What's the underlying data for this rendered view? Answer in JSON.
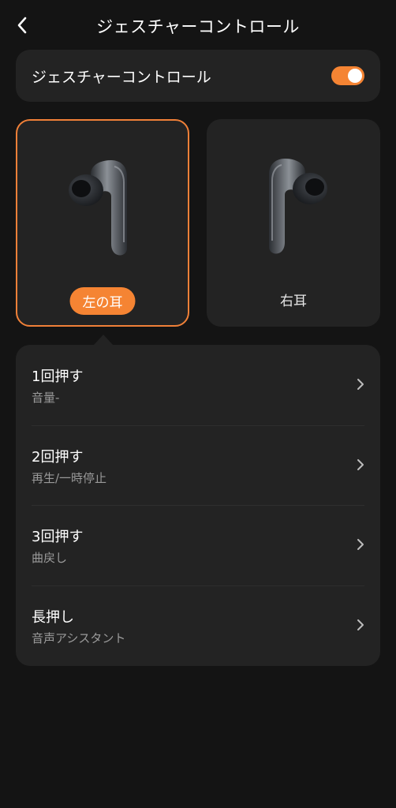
{
  "header": {
    "title": "ジェスチャーコントロール",
    "back_icon": "chevron-left-icon"
  },
  "gesture_toggle": {
    "label": "ジェスチャーコントロール",
    "enabled": true,
    "color": "#f58433"
  },
  "ears": [
    {
      "label": "左の耳",
      "selected": true
    },
    {
      "label": "右耳",
      "selected": false
    }
  ],
  "accent_color": "#f58433",
  "actions": [
    {
      "title": "1回押す",
      "value": "音量-"
    },
    {
      "title": "2回押す",
      "value": "再生/一時停止"
    },
    {
      "title": "3回押す",
      "value": "曲戻し"
    },
    {
      "title": "長押し",
      "value": "音声アシスタント"
    }
  ]
}
